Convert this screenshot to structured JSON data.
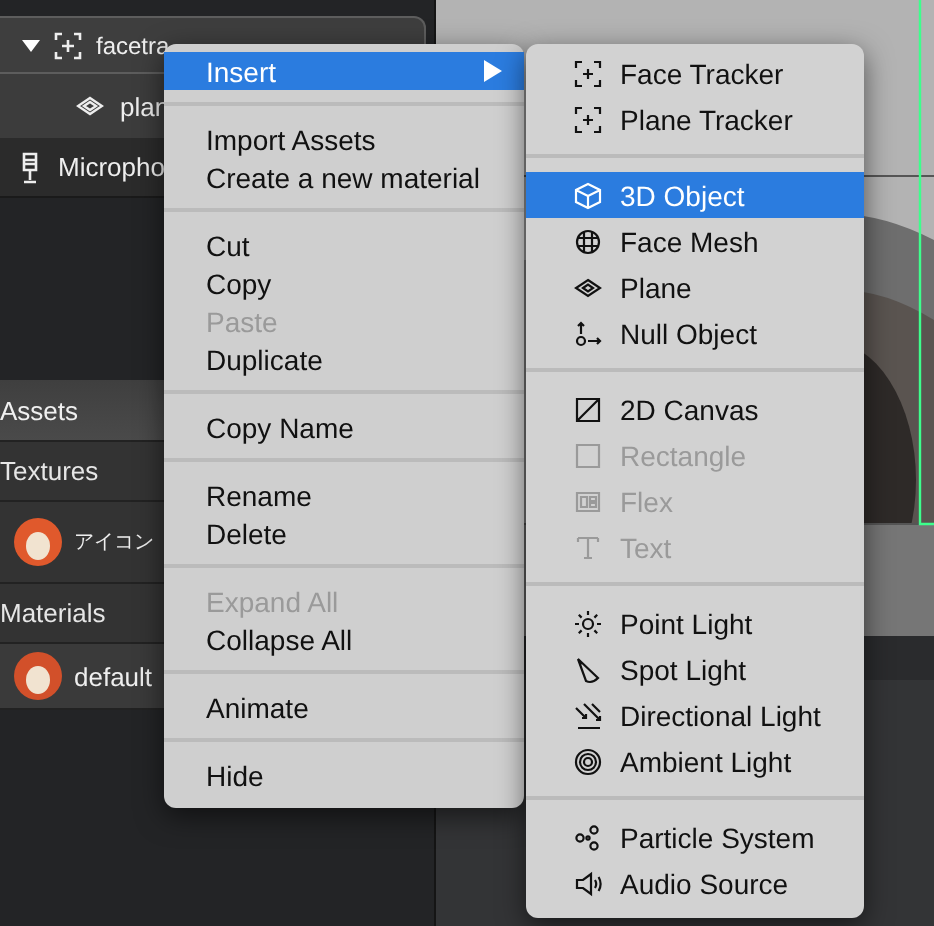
{
  "scene_tree": [
    {
      "label": "facetra",
      "kind": "tracker",
      "expanded": true,
      "selected": true
    },
    {
      "label": "plan",
      "kind": "plane",
      "selected": false
    },
    {
      "label": "Micropho",
      "kind": "microphone",
      "selected": false
    }
  ],
  "assets": {
    "title": "Assets",
    "sections": [
      {
        "title": "Textures",
        "items": [
          {
            "label": "アイコン"
          }
        ]
      },
      {
        "title": "Materials",
        "items": [
          {
            "label": "default"
          }
        ]
      }
    ]
  },
  "context_menu": {
    "groups": [
      [
        {
          "label": "Insert",
          "selected": true,
          "disabled": false,
          "submenu": true
        }
      ],
      [
        {
          "label": "Import Assets",
          "selected": false,
          "disabled": false
        },
        {
          "label": "Create a new material",
          "selected": false,
          "disabled": false
        }
      ],
      [
        {
          "label": "Cut",
          "selected": false,
          "disabled": false
        },
        {
          "label": "Copy",
          "selected": false,
          "disabled": false
        },
        {
          "label": "Paste",
          "selected": false,
          "disabled": true
        },
        {
          "label": "Duplicate",
          "selected": false,
          "disabled": false
        }
      ],
      [
        {
          "label": "Copy Name",
          "selected": false,
          "disabled": false
        }
      ],
      [
        {
          "label": "Rename",
          "selected": false,
          "disabled": false
        },
        {
          "label": "Delete",
          "selected": false,
          "disabled": false
        }
      ],
      [
        {
          "label": "Expand All",
          "selected": false,
          "disabled": true
        },
        {
          "label": "Collapse All",
          "selected": false,
          "disabled": false
        }
      ],
      [
        {
          "label": "Animate",
          "selected": false,
          "disabled": false
        }
      ],
      [
        {
          "label": "Hide",
          "selected": false,
          "disabled": false
        }
      ]
    ]
  },
  "insert_submenu": {
    "groups": [
      [
        {
          "label": "Face Tracker",
          "selected": false,
          "disabled": false
        },
        {
          "label": "Plane Tracker",
          "selected": false,
          "disabled": false
        }
      ],
      [
        {
          "label": "3D Object",
          "selected": true,
          "disabled": false
        },
        {
          "label": "Face Mesh",
          "selected": false,
          "disabled": false
        },
        {
          "label": "Plane",
          "selected": false,
          "disabled": false
        },
        {
          "label": "Null Object",
          "selected": false,
          "disabled": false
        }
      ],
      [
        {
          "label": "2D Canvas",
          "selected": false,
          "disabled": false
        },
        {
          "label": "Rectangle",
          "selected": false,
          "disabled": true
        },
        {
          "label": "Flex",
          "selected": false,
          "disabled": true
        },
        {
          "label": "Text",
          "selected": false,
          "disabled": true
        }
      ],
      [
        {
          "label": "Point Light",
          "selected": false,
          "disabled": false
        },
        {
          "label": "Spot Light",
          "selected": false,
          "disabled": false
        },
        {
          "label": "Directional Light",
          "selected": false,
          "disabled": false
        },
        {
          "label": "Ambient Light",
          "selected": false,
          "disabled": false
        }
      ],
      [
        {
          "label": "Particle System",
          "selected": false,
          "disabled": false
        },
        {
          "label": "Audio Source",
          "selected": false,
          "disabled": false
        }
      ]
    ]
  }
}
